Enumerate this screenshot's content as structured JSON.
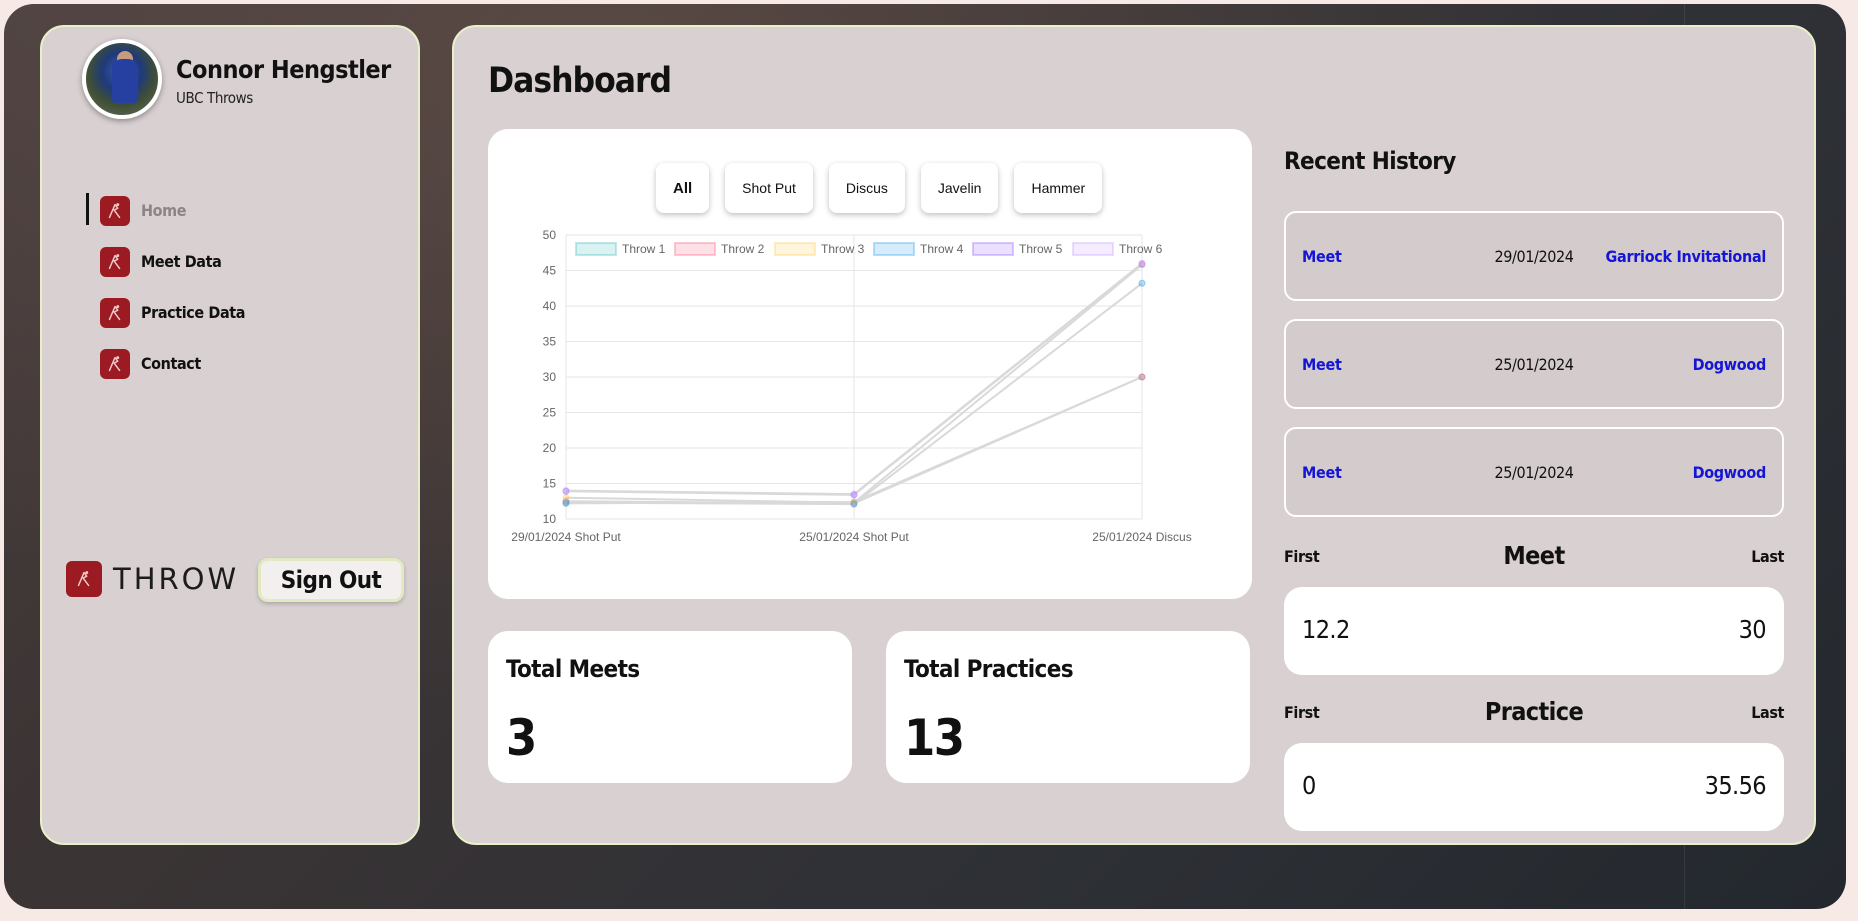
{
  "profile": {
    "name": "Connor Hengstler",
    "team": "UBC Throws"
  },
  "nav": {
    "items": [
      {
        "label": "Home",
        "active": true
      },
      {
        "label": "Meet Data",
        "active": false
      },
      {
        "label": "Practice Data",
        "active": false
      },
      {
        "label": "Contact",
        "active": false
      }
    ]
  },
  "brand": {
    "name": "THROW",
    "color": "#9c1a22"
  },
  "signout_label": "Sign Out",
  "page_title": "Dashboard",
  "filters": [
    "All",
    "Shot Put",
    "Discus",
    "Javelin",
    "Hammer"
  ],
  "active_filter": "All",
  "chart_data": {
    "type": "line",
    "categories": [
      "29/01/2024 Shot Put",
      "25/01/2024 Shot Put",
      "25/01/2024 Discus"
    ],
    "series": [
      {
        "name": "Throw 1",
        "values": [
          12.2,
          12.4,
          30
        ],
        "color": "#4bc0c0"
      },
      {
        "name": "Throw 2",
        "values": [
          12.5,
          12.2,
          30
        ],
        "color": "#ff6384"
      },
      {
        "name": "Throw 3",
        "values": [
          13.0,
          12.3,
          45.8
        ],
        "color": "#ffcd56"
      },
      {
        "name": "Throw 4",
        "values": [
          12.3,
          12.1,
          43.2
        ],
        "color": "#36a2eb"
      },
      {
        "name": "Throw 5",
        "values": [
          13.9,
          13.4,
          45.9
        ],
        "color": "#9966ff"
      },
      {
        "name": "Throw 6",
        "values": [
          14.0,
          13.5,
          46.0
        ],
        "color": "#c9a0ff"
      }
    ],
    "ylim": [
      10,
      50
    ],
    "yticks": [
      10,
      15,
      20,
      25,
      30,
      35,
      40,
      45,
      50
    ],
    "grid": true,
    "legend": "top"
  },
  "stats": {
    "meets": {
      "label": "Total Meets",
      "value": "3"
    },
    "practices": {
      "label": "Total Practices",
      "value": "13"
    }
  },
  "recent_history": {
    "title": "Recent History",
    "items": [
      {
        "type": "Meet",
        "date": "29/01/2024",
        "name": "Garriock Invitational"
      },
      {
        "type": "Meet",
        "date": "25/01/2024",
        "name": "Dogwood"
      },
      {
        "type": "Meet",
        "date": "25/01/2024",
        "name": "Dogwood"
      }
    ]
  },
  "first_last": {
    "meet": {
      "first_label": "First",
      "title": "Meet",
      "last_label": "Last",
      "first": "12.2",
      "last": "30"
    },
    "practice": {
      "first_label": "First",
      "title": "Practice",
      "last_label": "Last",
      "first": "0",
      "last": "35.56"
    }
  }
}
